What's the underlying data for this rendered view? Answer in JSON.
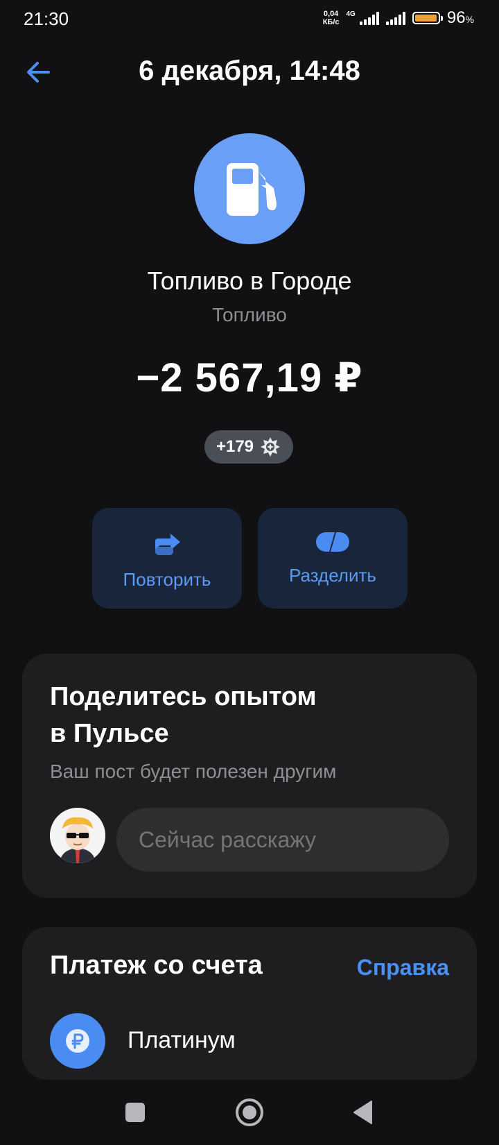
{
  "status_bar": {
    "time": "21:30",
    "speed_value": "0,04",
    "speed_unit": "КБ/с",
    "network": "4G",
    "battery_pct": "96",
    "battery_unit": "%",
    "battery_level": 0.96,
    "battery_color": "#f0a030"
  },
  "header": {
    "back_icon": "arrow-left-icon",
    "title": "6 декабря, 14:48"
  },
  "transaction": {
    "merchant_icon": "fuel-pump-icon",
    "merchant_name": "Топливо в Городе",
    "category": "Топливо",
    "amount": "−2 567,19 ₽",
    "bonus": "+179",
    "bonus_icon": "bonus-star-icon"
  },
  "actions": [
    {
      "label": "Повторить",
      "icon": "repeat-arrow-icon"
    },
    {
      "label": "Разделить",
      "icon": "split-icon"
    }
  ],
  "pulse": {
    "title_line1": "Поделитесь опытом",
    "title_line2": "в Пульсе",
    "subtitle": "Ваш пост будет полезен другим",
    "placeholder": "Сейчас расскажу"
  },
  "payment": {
    "title": "Платеж со счета",
    "help": "Справка",
    "account_name": "Платинум",
    "account_icon": "ruble-icon"
  },
  "colors": {
    "accent": "#4b90f3",
    "merchant_circle": "#6a9ff8",
    "background": "#111113",
    "card": "#1e1e21"
  }
}
